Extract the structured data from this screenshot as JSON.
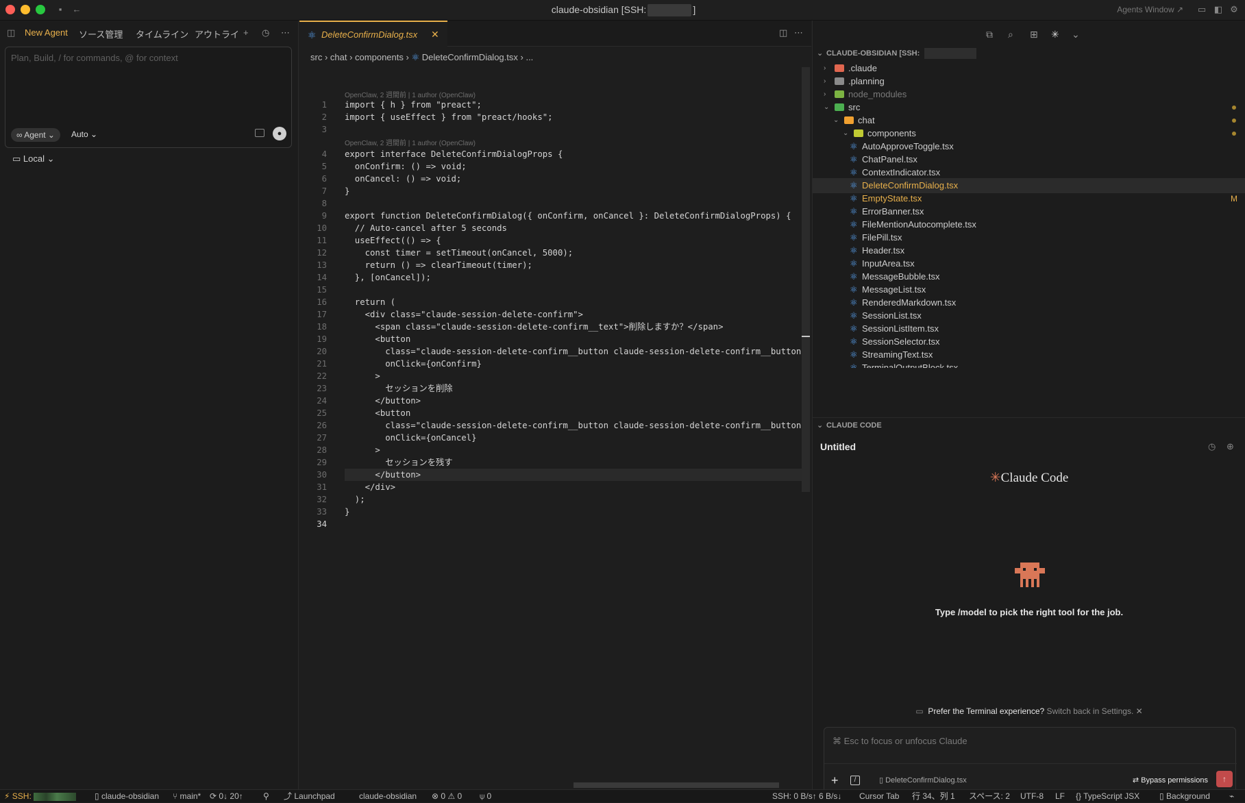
{
  "window": {
    "title_prefix": "claude-obsidian [SSH:",
    "title_suffix": "]",
    "agents_window": "Agents Window ↗"
  },
  "agent_panel": {
    "tabs": [
      "New Agent",
      "ソース管理",
      "タイムライン",
      "アウトライ"
    ],
    "prompt_placeholder": "Plan, Build, / for commands, @ for context",
    "mode_chip": "Agent",
    "model": "Auto",
    "location": "Local"
  },
  "editor": {
    "tab_name": "DeleteConfirmDialog.tsx",
    "breadcrumbs": [
      "src",
      "chat",
      "components",
      "DeleteConfirmDialog.tsx",
      "..."
    ],
    "blame": [
      "OpenClaw, 2 週間前 | 1 author (OpenClaw)",
      "OpenClaw, 2 週間前 | 1 author (OpenClaw)"
    ],
    "lines": [
      "import { h } from \"preact\";",
      "import { useEffect } from \"preact/hooks\";",
      "",
      "export interface DeleteConfirmDialogProps {",
      "  onConfirm: () => void;",
      "  onCancel: () => void;",
      "}",
      "",
      "export function DeleteConfirmDialog({ onConfirm, onCancel }: DeleteConfirmDialogProps) {",
      "  // Auto-cancel after 5 seconds",
      "  useEffect(() => {",
      "    const timer = setTimeout(onCancel, 5000);",
      "    return () => clearTimeout(timer);",
      "  }, [onCancel]);",
      "",
      "  return (",
      "    <div class=\"claude-session-delete-confirm\">",
      "      <span class=\"claude-session-delete-confirm__text\">削除しますか？</span>",
      "      <button",
      "        class=\"claude-session-delete-confirm__button claude-session-delete-confirm__button--co",
      "        onClick={onConfirm}",
      "      >",
      "        セッションを削除",
      "      </button>",
      "      <button",
      "        class=\"claude-session-delete-confirm__button claude-session-delete-confirm__button--ca",
      "        onClick={onCancel}",
      "      >",
      "        セッションを残す",
      "      </button>",
      "    </div>",
      "  );",
      "}",
      ""
    ]
  },
  "explorer": {
    "header": "CLAUDE-OBSIDIAN [SSH:",
    "items": [
      {
        "label": ".claude",
        "type": "folder",
        "depth": 0,
        "color": "#e0664f"
      },
      {
        "label": ".planning",
        "type": "folder",
        "depth": 0,
        "color": "#8a8a8a"
      },
      {
        "label": "node_modules",
        "type": "folder",
        "depth": 0,
        "color": "#7cb342"
      },
      {
        "label": "src",
        "type": "folder-open",
        "depth": 0,
        "color": "#4caf50"
      },
      {
        "label": "chat",
        "type": "folder-open",
        "depth": 1,
        "color": "#f0a030"
      },
      {
        "label": "components",
        "type": "folder-open",
        "depth": 2,
        "color": "#c0ca33"
      },
      {
        "label": "AutoApproveToggle.tsx",
        "type": "file",
        "depth": 3
      },
      {
        "label": "ChatPanel.tsx",
        "type": "file",
        "depth": 3
      },
      {
        "label": "ContextIndicator.tsx",
        "type": "file",
        "depth": 3
      },
      {
        "label": "DeleteConfirmDialog.tsx",
        "type": "file",
        "depth": 3
      },
      {
        "label": "EmptyState.tsx",
        "type": "file",
        "depth": 3
      },
      {
        "label": "ErrorBanner.tsx",
        "type": "file",
        "depth": 3
      },
      {
        "label": "FileMentionAutocomplete.tsx",
        "type": "file",
        "depth": 3
      },
      {
        "label": "FilePill.tsx",
        "type": "file",
        "depth": 3
      },
      {
        "label": "Header.tsx",
        "type": "file",
        "depth": 3
      },
      {
        "label": "InputArea.tsx",
        "type": "file",
        "depth": 3
      },
      {
        "label": "MessageBubble.tsx",
        "type": "file",
        "depth": 3
      },
      {
        "label": "MessageList.tsx",
        "type": "file",
        "depth": 3
      },
      {
        "label": "RenderedMarkdown.tsx",
        "type": "file",
        "depth": 3
      },
      {
        "label": "SessionList.tsx",
        "type": "file",
        "depth": 3
      },
      {
        "label": "SessionListItem.tsx",
        "type": "file",
        "depth": 3
      },
      {
        "label": "SessionSelector.tsx",
        "type": "file",
        "depth": 3
      },
      {
        "label": "StreamingText.tsx",
        "type": "file",
        "depth": 3
      },
      {
        "label": "TerminalOutputBlock.tsx",
        "type": "file",
        "depth": 3
      }
    ],
    "modified_badge": "M"
  },
  "claude_code": {
    "section": "CLAUDE CODE",
    "title": "Untitled",
    "logo": "Claude Code",
    "hint": "Type /model to pick the right tool for the job.",
    "pref_main": "Prefer the Terminal experience?",
    "pref_sub": "Switch back in Settings.",
    "input_placeholder": "⌘ Esc to focus or unfocus Claude",
    "attached_file": "DeleteConfirmDialog.tsx",
    "bypass": "Bypass permissions"
  },
  "statusbar": {
    "ssh": "SSH:",
    "workspace": "claude-obsidian",
    "branch": "main*",
    "sync": "0↓ 20↑",
    "launchpad": "Launchpad",
    "project": "claude-obsidian",
    "problems": "0 ⚠ 0",
    "ports": "0",
    "ssh_rate": "SSH: 0 B/s↑ 6 B/s↓",
    "cursor_tab": "Cursor Tab",
    "position": "行 34、列 1",
    "spaces": "スペース: 2",
    "encoding": "UTF-8",
    "eol": "LF",
    "language": "TypeScript JSX",
    "background": "Background"
  },
  "colors": {
    "accent": "#e8b04b",
    "react": "#59a4f5",
    "claude": "#d97757"
  }
}
